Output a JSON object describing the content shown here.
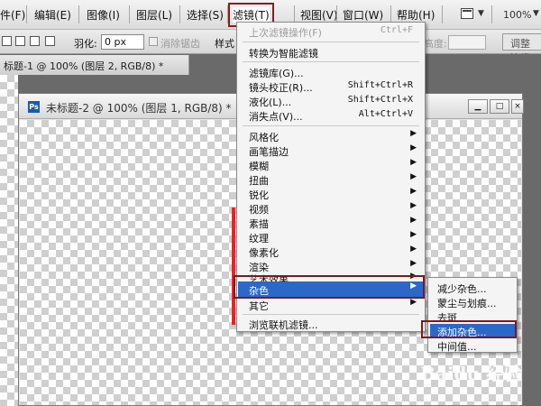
{
  "menubar": {
    "items": [
      {
        "label": "件(F)"
      },
      {
        "label": "编辑(E)"
      },
      {
        "label": "图像(I)"
      },
      {
        "label": "图层(L)"
      },
      {
        "label": "选择(S)"
      },
      {
        "label": "滤镜(T)"
      },
      {
        "label": "视图(V)"
      },
      {
        "label": "窗口(W)"
      },
      {
        "label": "帮助(H)"
      }
    ],
    "zoom": "100%"
  },
  "options": {
    "feather_label": "羽化:",
    "feather_value": "0 px",
    "antialias_label": "消除锯齿",
    "style_label": "样式",
    "height_label": "高度:",
    "refine_button": "调整边缘"
  },
  "documents": {
    "back_tab": "标题-1 @ 100% (图层 2, RGB/8) *",
    "front_title": "未标题-2 @ 100% (图层 1, RGB/8) *"
  },
  "filter_menu": {
    "last_filter": "上次滤镜操作(F)",
    "last_filter_shortcut": "Ctrl+F",
    "convert_smart": "转换为智能滤镜",
    "gallery": "滤镜库(G)...",
    "lens_correction": "镜头校正(R)...",
    "lens_correction_shortcut": "Shift+Ctrl+R",
    "liquify": "液化(L)...",
    "liquify_shortcut": "Shift+Ctrl+X",
    "vanishing_point": "消失点(V)...",
    "vanishing_point_shortcut": "Alt+Ctrl+V",
    "categories": [
      "风格化",
      "画笔描边",
      "模糊",
      "扭曲",
      "锐化",
      "视频",
      "素描",
      "纹理",
      "像素化",
      "渲染",
      "艺术效果",
      "杂色",
      "其它"
    ],
    "browse_online": "浏览联机滤镜..."
  },
  "noise_submenu": {
    "items": [
      "减少杂色...",
      "蒙尘与划痕...",
      "去斑",
      "添加杂色...",
      "中间值..."
    ],
    "highlighted": "添加杂色..."
  },
  "watermark": "Baidu 经验",
  "colors": {
    "highlight": "#2b68c8",
    "annotation_box": "#7a1a1e",
    "red_bar": "#e32629"
  }
}
